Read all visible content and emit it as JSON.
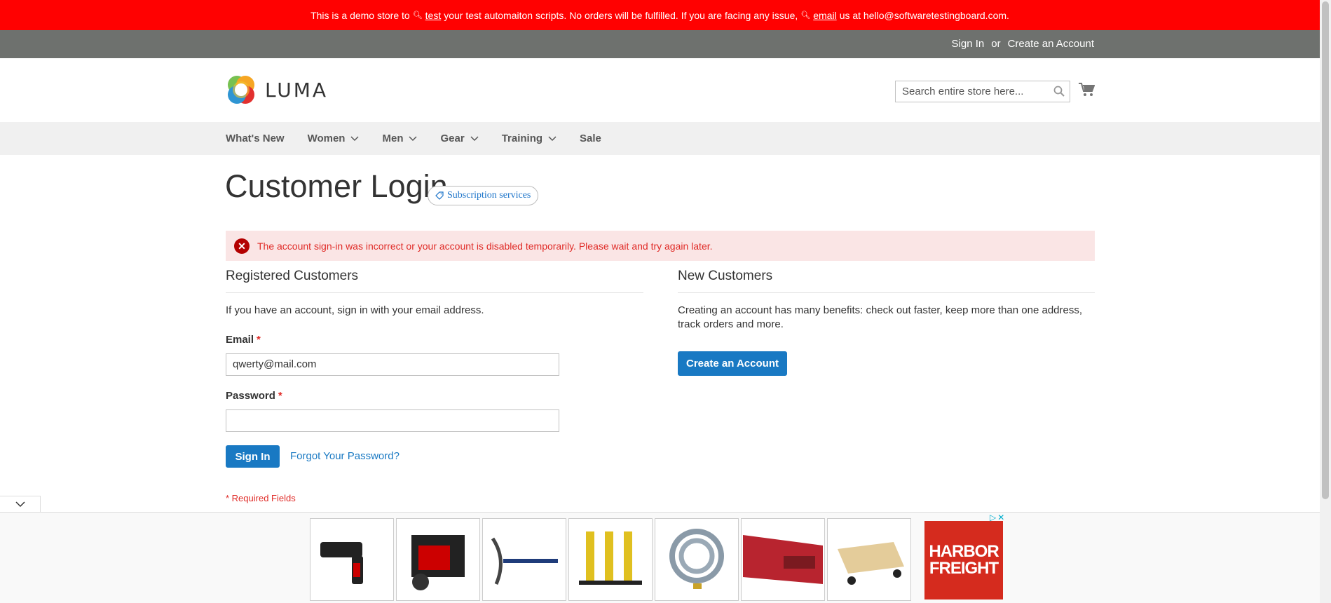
{
  "demo_notice": {
    "part1": "This is a demo store to",
    "test_link": "test",
    "part2": "your test automaiton scripts. No orders will be fulfilled. If you are facing any issue,",
    "email_link": "email",
    "part3": "us at hello@softwaretestingboard.com."
  },
  "top_links": {
    "sign_in": "Sign In",
    "or": "or",
    "create_account": "Create an Account"
  },
  "header": {
    "logo_text": "LUMA",
    "search_placeholder": "Search entire store here..."
  },
  "nav": {
    "items": [
      {
        "label": "What's New"
      },
      {
        "label": "Women"
      },
      {
        "label": "Men"
      },
      {
        "label": "Gear"
      },
      {
        "label": "Training"
      },
      {
        "label": "Sale"
      }
    ]
  },
  "page": {
    "title": "Customer Login",
    "badge": "Subscription services"
  },
  "error_message": "The account sign-in was incorrect or your account is disabled temporarily. Please wait and try again later.",
  "registered": {
    "title": "Registered Customers",
    "intro": "If you have an account, sign in with your email address.",
    "email_label": "Email",
    "email_value": "qwerty@mail.com",
    "password_label": "Password",
    "password_value": "",
    "required_mark": "*",
    "sign_in_button": "Sign In",
    "forgot_link": "Forgot Your Password?",
    "required_note": "* Required Fields"
  },
  "new_customers": {
    "title": "New Customers",
    "text": "Creating an account has many benefits: check out faster, keep more than one address, track orders and more.",
    "button": "Create an Account"
  },
  "ad": {
    "brand_line1": "HARBOR",
    "brand_line2": "FREIGHT",
    "products": [
      "drill-icon",
      "generator-icon",
      "pickaxe-icon",
      "stands-icon",
      "hose-icon",
      "truck-bed-icon",
      "dolly-icon"
    ]
  },
  "colors": {
    "demo_bar": "#ff0101",
    "top_bar": "#6e716e",
    "nav": "#f0f0f0",
    "accent": "#1979c3",
    "error_bg": "#fae5e5",
    "error_text": "#e02b27",
    "ad_brand": "#d52b1e"
  }
}
